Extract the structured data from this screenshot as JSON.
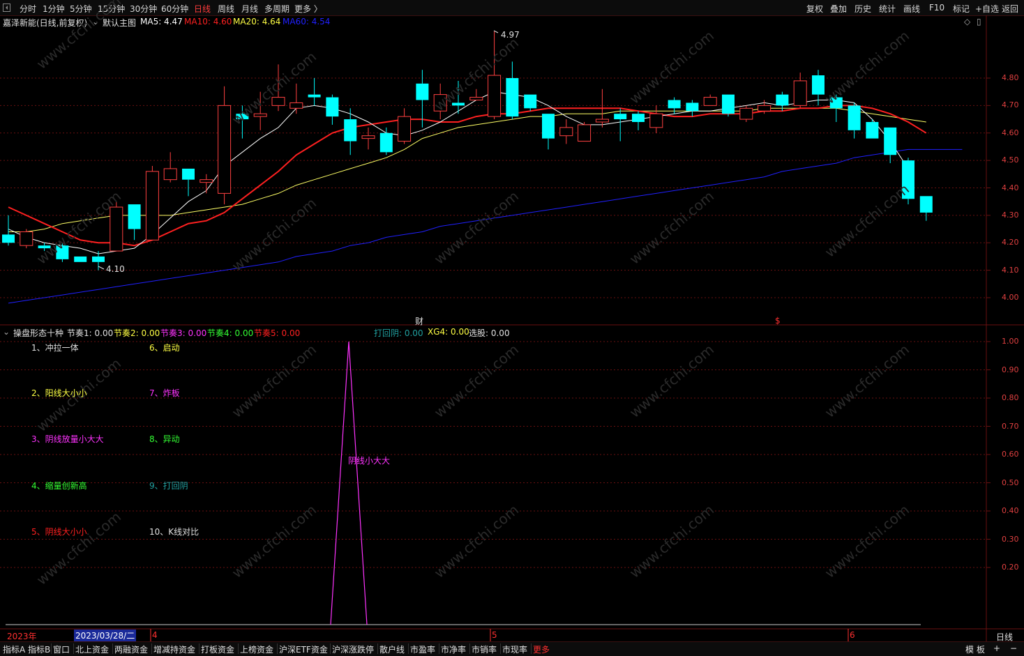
{
  "colors": {
    "up": "#ff4040",
    "down": "#00ffff",
    "ma5": "#ffffff",
    "ma10": "#ff2020",
    "ma20": "#ffff66",
    "ma60": "#2020ff",
    "grid": "#6a1010",
    "pink": "#ff33ff",
    "bg": "#000000"
  },
  "topbar": {
    "periods": [
      "分时",
      "1分钟",
      "5分钟",
      "15分钟",
      "30分钟",
      "60分钟",
      "日线",
      "周线",
      "月线",
      "多周期",
      "更多 〉"
    ],
    "active_period": "日线",
    "right_buttons": [
      "复权",
      "叠加",
      "历史",
      "统计",
      "画线",
      "F10",
      "标记",
      "+自选",
      "返回"
    ]
  },
  "main_header": {
    "stock": "嘉泽新能(日线,前复权)",
    "template": "默认主图",
    "ma5": "MA5: 4.47",
    "ma10": "MA10: 4.60",
    "ma20": "MA20: 4.64",
    "ma60": "MA60: 4.54"
  },
  "price_axis": [
    "4.80",
    "4.70",
    "4.60",
    "4.50",
    "4.40",
    "4.30",
    "4.20",
    "4.10",
    "4.00"
  ],
  "annotations": {
    "high": "4.97",
    "low": "4.10",
    "cai": "财",
    "dollar": "$"
  },
  "chart_data": {
    "type": "candlestick",
    "ylim": [
      3.95,
      5.0
    ],
    "candles": [
      {
        "o": 4.23,
        "c": 4.2,
        "h": 4.3,
        "l": 4.19
      },
      {
        "o": 4.19,
        "c": 4.24,
        "h": 4.25,
        "l": 4.18
      },
      {
        "o": 4.19,
        "c": 4.18,
        "h": 4.2,
        "l": 4.17
      },
      {
        "o": 4.19,
        "c": 4.14,
        "h": 4.2,
        "l": 4.13
      },
      {
        "o": 4.15,
        "c": 4.13,
        "h": 4.15,
        "l": 4.13
      },
      {
        "o": 4.15,
        "c": 4.13,
        "h": 4.17,
        "l": 4.1
      },
      {
        "o": 4.17,
        "c": 4.33,
        "h": 4.35,
        "l": 4.17
      },
      {
        "o": 4.34,
        "c": 4.25,
        "h": 4.34,
        "l": 4.21
      },
      {
        "o": 4.21,
        "c": 4.46,
        "h": 4.48,
        "l": 4.21
      },
      {
        "o": 4.43,
        "c": 4.47,
        "h": 4.53,
        "l": 4.42
      },
      {
        "o": 4.47,
        "c": 4.43,
        "h": 4.47,
        "l": 4.37
      },
      {
        "o": 4.42,
        "c": 4.43,
        "h": 4.45,
        "l": 4.38
      },
      {
        "o": 4.38,
        "c": 4.7,
        "h": 4.77,
        "l": 4.34
      },
      {
        "o": 4.67,
        "c": 4.65,
        "h": 4.7,
        "l": 4.58
      },
      {
        "o": 4.66,
        "c": 4.67,
        "h": 4.75,
        "l": 4.61
      },
      {
        "o": 4.7,
        "c": 4.73,
        "h": 4.85,
        "l": 4.68
      },
      {
        "o": 4.69,
        "c": 4.71,
        "h": 4.78,
        "l": 4.67
      },
      {
        "o": 4.74,
        "c": 4.73,
        "h": 4.8,
        "l": 4.7
      },
      {
        "o": 4.73,
        "c": 4.66,
        "h": 4.74,
        "l": 4.63
      },
      {
        "o": 4.65,
        "c": 4.57,
        "h": 4.69,
        "l": 4.52
      },
      {
        "o": 4.58,
        "c": 4.59,
        "h": 4.62,
        "l": 4.54
      },
      {
        "o": 4.6,
        "c": 4.53,
        "h": 4.62,
        "l": 4.52
      },
      {
        "o": 4.57,
        "c": 4.66,
        "h": 4.69,
        "l": 4.56
      },
      {
        "o": 4.78,
        "c": 4.72,
        "h": 4.83,
        "l": 4.62
      },
      {
        "o": 4.68,
        "c": 4.74,
        "h": 4.78,
        "l": 4.65
      },
      {
        "o": 4.71,
        "c": 4.7,
        "h": 4.79,
        "l": 4.67
      },
      {
        "o": 4.72,
        "c": 4.73,
        "h": 4.76,
        "l": 4.72
      },
      {
        "o": 4.66,
        "c": 4.81,
        "h": 4.97,
        "l": 4.65
      },
      {
        "o": 4.8,
        "c": 4.66,
        "h": 4.86,
        "l": 4.65
      },
      {
        "o": 4.74,
        "c": 4.69,
        "h": 4.74,
        "l": 4.68
      },
      {
        "o": 4.67,
        "c": 4.58,
        "h": 4.67,
        "l": 4.54
      },
      {
        "o": 4.59,
        "c": 4.62,
        "h": 4.65,
        "l": 4.56
      },
      {
        "o": 4.57,
        "c": 4.63,
        "h": 4.64,
        "l": 4.57
      },
      {
        "o": 4.64,
        "c": 4.65,
        "h": 4.76,
        "l": 4.62
      },
      {
        "o": 4.67,
        "c": 4.65,
        "h": 4.69,
        "l": 4.57
      },
      {
        "o": 4.67,
        "c": 4.64,
        "h": 4.68,
        "l": 4.61
      },
      {
        "o": 4.62,
        "c": 4.67,
        "h": 4.7,
        "l": 4.6
      },
      {
        "o": 4.72,
        "c": 4.69,
        "h": 4.73,
        "l": 4.67
      },
      {
        "o": 4.71,
        "c": 4.68,
        "h": 4.72,
        "l": 4.66
      },
      {
        "o": 4.7,
        "c": 4.73,
        "h": 4.74,
        "l": 4.7
      },
      {
        "o": 4.74,
        "c": 4.67,
        "h": 4.74,
        "l": 4.66
      },
      {
        "o": 4.65,
        "c": 4.69,
        "h": 4.7,
        "l": 4.64
      },
      {
        "o": 4.68,
        "c": 4.7,
        "h": 4.72,
        "l": 4.67
      },
      {
        "o": 4.74,
        "c": 4.7,
        "h": 4.75,
        "l": 4.68
      },
      {
        "o": 4.7,
        "c": 4.79,
        "h": 4.82,
        "l": 4.69
      },
      {
        "o": 4.81,
        "c": 4.74,
        "h": 4.83,
        "l": 4.7
      },
      {
        "o": 4.73,
        "c": 4.69,
        "h": 4.74,
        "l": 4.64
      },
      {
        "o": 4.7,
        "c": 4.61,
        "h": 4.71,
        "l": 4.58
      },
      {
        "o": 4.64,
        "c": 4.58,
        "h": 4.65,
        "l": 4.58
      },
      {
        "o": 4.62,
        "c": 4.52,
        "h": 4.62,
        "l": 4.49
      },
      {
        "o": 4.5,
        "c": 4.36,
        "h": 4.51,
        "l": 4.34
      },
      {
        "o": 4.37,
        "c": 4.31,
        "h": 4.37,
        "l": 4.28
      }
    ],
    "ma5": [
      4.25,
      4.22,
      4.2,
      4.19,
      4.18,
      4.16,
      4.17,
      4.18,
      4.23,
      4.29,
      4.35,
      4.39,
      4.48,
      4.53,
      4.58,
      4.62,
      4.69,
      4.7,
      4.69,
      4.67,
      4.64,
      4.6,
      4.59,
      4.61,
      4.64,
      4.68,
      4.72,
      4.75,
      4.74,
      4.73,
      4.7,
      4.66,
      4.63,
      4.63,
      4.64,
      4.65,
      4.66,
      4.67,
      4.68,
      4.68,
      4.69,
      4.7,
      4.71,
      4.7,
      4.71,
      4.72,
      4.72,
      4.71,
      4.65,
      4.57,
      4.47
    ],
    "ma10": [
      4.33,
      4.3,
      4.27,
      4.24,
      4.21,
      4.2,
      4.2,
      4.19,
      4.21,
      4.24,
      4.27,
      4.28,
      4.31,
      4.36,
      4.41,
      4.46,
      4.52,
      4.56,
      4.6,
      4.62,
      4.63,
      4.64,
      4.65,
      4.65,
      4.64,
      4.64,
      4.66,
      4.67,
      4.67,
      4.68,
      4.69,
      4.69,
      4.69,
      4.69,
      4.69,
      4.68,
      4.67,
      4.66,
      4.66,
      4.67,
      4.67,
      4.67,
      4.68,
      4.68,
      4.69,
      4.69,
      4.7,
      4.7,
      4.69,
      4.67,
      4.64,
      4.6
    ],
    "ma20": [
      4.24,
      4.24,
      4.25,
      4.27,
      4.28,
      4.29,
      4.3,
      4.3,
      4.3,
      4.3,
      4.31,
      4.32,
      4.33,
      4.34,
      4.36,
      4.38,
      4.41,
      4.43,
      4.45,
      4.47,
      4.49,
      4.51,
      4.54,
      4.58,
      4.6,
      4.62,
      4.63,
      4.64,
      4.65,
      4.66,
      4.66,
      4.67,
      4.67,
      4.67,
      4.68,
      4.68,
      4.68,
      4.68,
      4.68,
      4.68,
      4.68,
      4.68,
      4.69,
      4.69,
      4.69,
      4.69,
      4.69,
      4.68,
      4.67,
      4.66,
      4.65,
      4.64
    ],
    "ma60": [
      3.98,
      3.99,
      4.0,
      4.01,
      4.02,
      4.03,
      4.04,
      4.05,
      4.06,
      4.07,
      4.08,
      4.09,
      4.1,
      4.11,
      4.12,
      4.13,
      4.15,
      4.16,
      4.17,
      4.19,
      4.2,
      4.22,
      4.23,
      4.24,
      4.26,
      4.27,
      4.28,
      4.29,
      4.3,
      4.31,
      4.32,
      4.33,
      4.34,
      4.35,
      4.36,
      4.37,
      4.38,
      4.39,
      4.4,
      4.41,
      4.42,
      4.43,
      4.44,
      4.46,
      4.47,
      4.48,
      4.49,
      4.51,
      4.52,
      4.53,
      4.54,
      4.54,
      4.54,
      4.54
    ]
  },
  "indicator_header": {
    "name": "操盘形态十种",
    "items": [
      {
        "text": "节奏1: 0.00",
        "color": "#e0e0e0"
      },
      {
        "text": "节奏2: 0.00",
        "color": "#ffff44"
      },
      {
        "text": "节奏3: 0.00",
        "color": "#ff33ff"
      },
      {
        "text": "节奏4: 0.00",
        "color": "#33ff33"
      },
      {
        "text": "节奏5: 0.00",
        "color": "#ff2020"
      }
    ],
    "items_right": [
      {
        "text": "打回阴: 0.00",
        "color": "#20a0a0"
      },
      {
        "text": "XG4: 0.00",
        "color": "#ffff44"
      },
      {
        "text": "选股: 0.00",
        "color": "#e0e0e0"
      }
    ]
  },
  "indicator_axis": [
    "1.00",
    "0.90",
    "0.80",
    "0.70",
    "0.60",
    "0.50",
    "0.40",
    "0.30",
    "0.20"
  ],
  "indicator_legend": [
    {
      "text": "1、冲拉一体",
      "color": "#e0e0e0"
    },
    {
      "text": "2、阳线大小小",
      "color": "#ffff44"
    },
    {
      "text": "3、阴线放量小大大",
      "color": "#ff33ff"
    },
    {
      "text": "4、缩量创新高",
      "color": "#33ff33"
    },
    {
      "text": "5、阴线大小小",
      "color": "#ff2020"
    },
    {
      "text": "6、启动",
      "color": "#ffff44"
    },
    {
      "text": "7、炸板",
      "color": "#ff33ff"
    },
    {
      "text": "8、异动",
      "color": "#33ff33"
    },
    {
      "text": "9、打回阴",
      "color": "#20a0a0"
    },
    {
      "text": "10、K线对比",
      "color": "#e0e0e0"
    }
  ],
  "indicator_signal": {
    "label": "阴线小大大",
    "value": 1.0
  },
  "time_axis": {
    "year": "2023年",
    "cursor_date": "2023/03/28/二",
    "months": [
      "4",
      "5",
      "6"
    ],
    "period": "日线"
  },
  "bottombar": {
    "tabs": [
      "指标A",
      "指标B",
      "窗口",
      "北上资金",
      "两融资金",
      "增减持资金",
      "打板资金",
      "上榜资金",
      "沪深ETF资金",
      "沪深涨跌停",
      "散户线",
      "市盈率",
      "市净率",
      "市销率",
      "市现率",
      "更多"
    ],
    "right": [
      "模",
      "板",
      "+",
      "−"
    ]
  },
  "watermark": "www.cfchi.com"
}
